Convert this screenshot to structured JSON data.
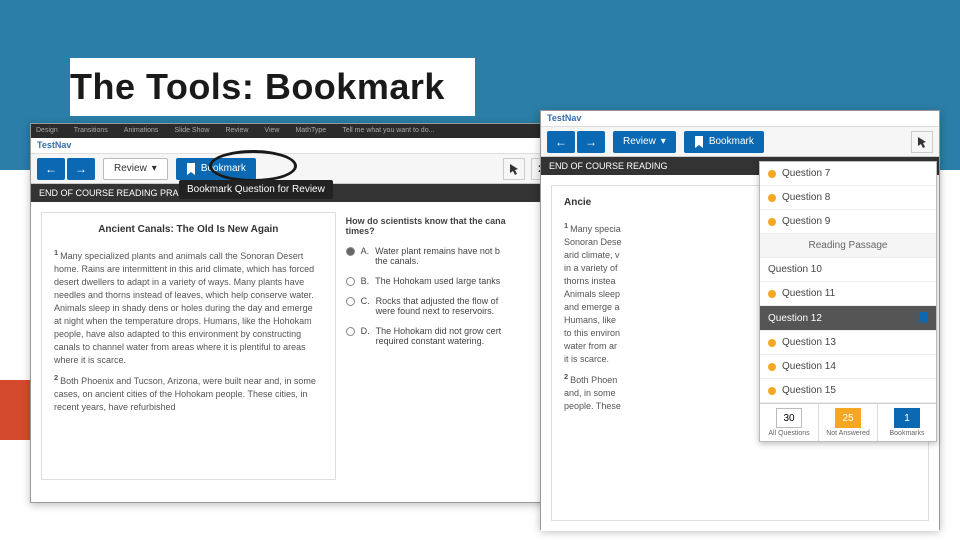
{
  "slide_title": "The Tools: Bookmark",
  "office_tabs": [
    "Design",
    "Transitions",
    "Animations",
    "Slide Show",
    "Review",
    "View",
    "MathType",
    "Tell me what you want to do..."
  ],
  "app_name": "TestNav",
  "toolbar": {
    "back": "←",
    "fwd": "→",
    "review": "Review",
    "bookmark": "Bookmark",
    "pointer": "▲",
    "close": "✕"
  },
  "tooltip": "Bookmark Question for Review",
  "crumb_left": "END OF COURSE READING PRACT",
  "crumb_right": "END OF COURSE READING",
  "passage": {
    "title": "Ancient Canals: The Old Is New Again",
    "title_short": "Ancie",
    "p1": "Many specialized plants and animals call the Sonoran Desert home. Rains are intermittent in this arid climate, which has forced desert dwellers to adapt in a variety of ways. Many plants have needles and thorns instead of leaves, which help conserve water. Animals sleep in shady dens or holes during the day and emerge at night when the temperature drops. Humans, like the Hohokam people, have also adapted to this environment by constructing canals to channel water from areas where it is plentiful to areas where it is scarce.",
    "p2": "Both Phoenix and Tucson, Arizona, were built near and, in some cases, on ancient cities of the Hohokam people. These cities, in recent years, have refurbished",
    "p1_frags": [
      "Many specia",
      "Sonoran Dese",
      "arid climate, v",
      "in a variety of",
      "thorns instea",
      "Animals sleep",
      "and emerge a",
      "Humans, like",
      "to this environ",
      "water from ar",
      "it is scarce."
    ],
    "p2_frags": [
      "Both Phoen",
      "and, in some",
      "people. These"
    ]
  },
  "question": {
    "stem": "How do scientists know that the cana",
    "stem2": "times?",
    "A": "Water plant remains have not b",
    "A2": "the canals.",
    "B": "The Hohokam used large tanks",
    "C": "Rocks that adjusted the flow of",
    "C2": "were found next to reservoirs.",
    "D": "The Hohokam did not grow cert",
    "D2": "required constant watering."
  },
  "dropdown": {
    "items": [
      {
        "label": "Question 7",
        "dot": true
      },
      {
        "label": "Question 8",
        "dot": true
      },
      {
        "label": "Question 9",
        "dot": true
      },
      {
        "label": "Reading Passage",
        "hdr": true
      },
      {
        "label": "Question 10"
      },
      {
        "label": "Question 11",
        "dot": true
      },
      {
        "label": "Question 12",
        "active": true,
        "bm": true
      },
      {
        "label": "Question 13",
        "dot": true
      },
      {
        "label": "Question 14",
        "dot": true
      },
      {
        "label": "Question 15",
        "dot": true
      }
    ],
    "footer": {
      "all": {
        "n": "30",
        "l": "All Questions"
      },
      "na": {
        "n": "25",
        "l": "Not Answered"
      },
      "bm": {
        "n": "1",
        "l": "Bookmarks"
      }
    }
  }
}
